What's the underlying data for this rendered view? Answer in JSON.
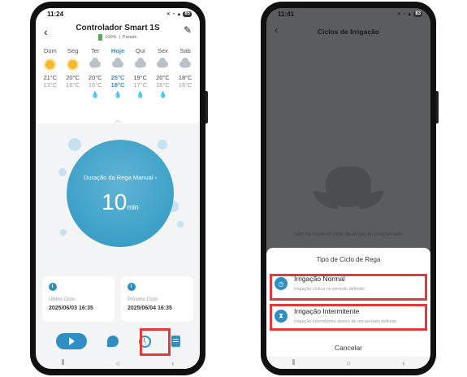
{
  "phone1": {
    "status": {
      "time": "11:24",
      "battery": "85"
    },
    "header": {
      "title": "Controlador Smart 1S",
      "battery_pct": "100%",
      "state": "Parado"
    },
    "weather": [
      {
        "day": "Dom",
        "icon": "sun-icon",
        "hi": "21°C",
        "lo": "13°C",
        "rain": false
      },
      {
        "day": "Seg",
        "icon": "sun-icon",
        "hi": "20°C",
        "lo": "16°C",
        "rain": false
      },
      {
        "day": "Ter",
        "icon": "rain-cloud-icon",
        "hi": "20°C",
        "lo": "16°C",
        "rain": true
      },
      {
        "day": "Hoje",
        "icon": "cloud-icon",
        "hi": "25°C",
        "lo": "18°C",
        "rain": true
      },
      {
        "day": "Qui",
        "icon": "rain-cloud-icon",
        "hi": "19°C",
        "lo": "17°C",
        "rain": true
      },
      {
        "day": "Sex",
        "icon": "rain-cloud-icon",
        "hi": "20°C",
        "lo": "16°C",
        "rain": true
      },
      {
        "day": "Sab",
        "icon": "rain-cloud-icon",
        "hi": "18°C",
        "lo": "16°C",
        "rain": false
      }
    ],
    "manual": {
      "label": "Duração da Rega Manual",
      "value": "10",
      "unit": "min"
    },
    "last_cycle": {
      "label": "Último Ciclo",
      "value": "2025/06/03 16:35"
    },
    "next_cycle": {
      "label": "Próximo Ciclo",
      "value": "2025/06/04 16:35"
    }
  },
  "phone2": {
    "status": {
      "time": "11:41",
      "battery": "83"
    },
    "header": {
      "title": "Ciclos de Irrigação"
    },
    "empty_text": "Não há nenhum ciclo de irrigação programado",
    "sheet": {
      "title": "Tipo de Ciclo de Rega",
      "options": [
        {
          "title": "Irrigação Normal",
          "desc": "Irrigação cíclica no período definido"
        },
        {
          "title": "Irrigação Intermitente",
          "desc": "Irrigação intermitente dentro de um período definido"
        }
      ],
      "cancel": "Cancelar"
    }
  },
  "colors": {
    "accent": "#2f8fc4",
    "highlight": "#e23a3a"
  }
}
